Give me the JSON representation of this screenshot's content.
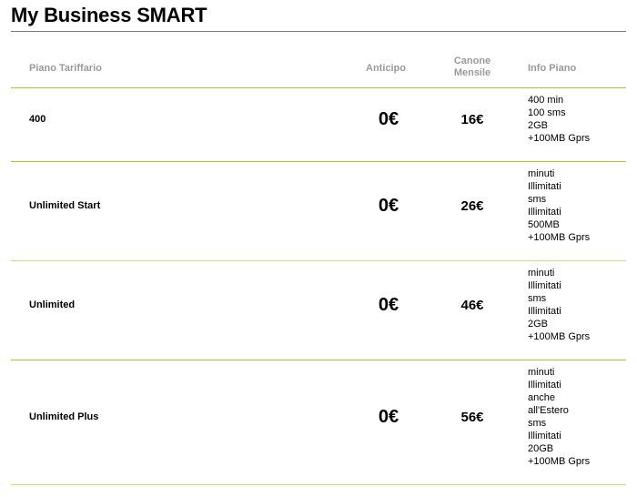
{
  "page": {
    "title": "My Business SMART"
  },
  "table": {
    "headers": {
      "plan": "Piano Tariffario",
      "anticipo": "Anticipo",
      "canone_line1": "Canone",
      "canone_line2": "Mensile",
      "info": "Info Piano"
    },
    "rows": [
      {
        "plan": "400",
        "anticipo": "0€",
        "canone": "16€",
        "info": [
          "400 min",
          "100 sms",
          "2GB",
          "+100MB Gprs"
        ]
      },
      {
        "plan": "Unlimited Start",
        "anticipo": "0€",
        "canone": "26€",
        "info": [
          "minuti",
          "Illimitati",
          "sms",
          "Illimitati",
          "500MB",
          "+100MB Gprs"
        ]
      },
      {
        "plan": "Unlimited",
        "anticipo": "0€",
        "canone": "46€",
        "info": [
          "minuti",
          "Illimitati",
          "sms",
          "Illimitati",
          "2GB",
          "+100MB Gprs"
        ]
      },
      {
        "plan": "Unlimited Plus",
        "anticipo": "0€",
        "canone": "56€",
        "info": [
          "minuti",
          "Illimitati",
          "anche",
          "all'Estero",
          "sms",
          "Illimitati",
          "20GB",
          "+100MB Gprs"
        ]
      }
    ]
  },
  "colors": {
    "accent": "#a6c92a",
    "header_text": "#9a9a9a"
  }
}
